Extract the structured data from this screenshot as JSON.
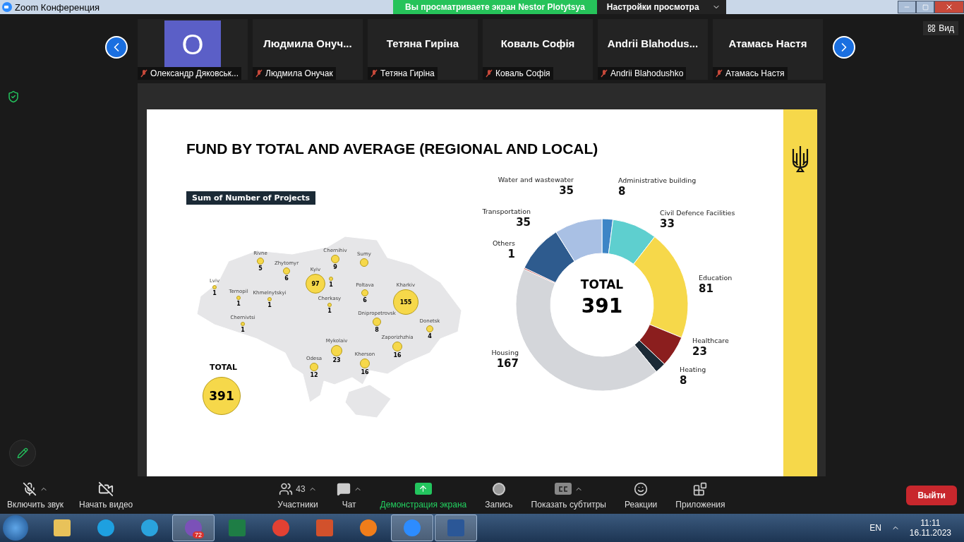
{
  "window": {
    "title": "Zoom Конференция"
  },
  "share_banner": {
    "text": "Вы просматриваете экран Nestor Plotytsya",
    "view_options": "Настройки просмотра"
  },
  "view_button": "Вид",
  "participants": [
    {
      "kind": "avatar",
      "tile_text": "O",
      "name": "Олександр Дяковськ...",
      "muted": true
    },
    {
      "kind": "name",
      "tile_text": "Людмила  Онуч...",
      "name": "Людмила Онучак",
      "muted": true
    },
    {
      "kind": "name",
      "tile_text": "Тетяна Гиріна",
      "name": "Тетяна Гиріна",
      "muted": true
    },
    {
      "kind": "name",
      "tile_text": "Коваль Софія",
      "name": "Коваль Софія",
      "muted": true
    },
    {
      "kind": "name",
      "tile_text": "Andrii  Blahodus...",
      "name": "Andrii Blahodushko",
      "muted": true
    },
    {
      "kind": "name",
      "tile_text": "Атамась Настя",
      "name": "Атамась Настя",
      "muted": true
    }
  ],
  "slide": {
    "title": "FUND BY TOTAL AND AVERAGE (REGIONAL AND LOCAL)",
    "map_label": "Sum of Number of Projects",
    "regions": [
      {
        "name": "Rivne",
        "value": "5"
      },
      {
        "name": "Chernihiv",
        "value": "9"
      },
      {
        "name": "Sumy"
      },
      {
        "name": "Zhytomyr",
        "value": "6"
      },
      {
        "name": "Kyiv",
        "value": "97"
      },
      {
        "value": "1"
      },
      {
        "name": "Lviv",
        "value": "1"
      },
      {
        "name": "Poltava",
        "value": "6"
      },
      {
        "name": "Ternopil",
        "value": "1"
      },
      {
        "name": "Khmelnytskyi",
        "value": "1"
      },
      {
        "name": "Kharkiv",
        "value": "155"
      },
      {
        "name": "Cherkasy",
        "value": "1"
      },
      {
        "name": "Chernivtsi",
        "value": "1"
      },
      {
        "name": "Dnipropetrovsk",
        "value": "8"
      },
      {
        "name": "Donetsk",
        "value": "4"
      },
      {
        "name": "Zaporizhzhia",
        "value": "16"
      },
      {
        "name": "Mykolaiv",
        "value": "23"
      },
      {
        "name": "Kherson",
        "value": "16"
      },
      {
        "name": "Odesa",
        "value": "12"
      }
    ],
    "total_label": "TOTAL",
    "total_value": "391",
    "donut_total_label": "TOTAL",
    "donut_total_value": "391",
    "chart_data": {
      "type": "donut",
      "data_labels": true,
      "categories": [
        "Administrative building",
        "Civil Defence Facilities",
        "Education",
        "Healthcare",
        "Heating",
        "Housing",
        "Others",
        "Transportation",
        "Water and wastewater"
      ],
      "values": [
        8,
        33,
        81,
        23,
        8,
        167,
        1,
        35,
        35
      ],
      "colors": [
        "#3d85c6",
        "#5ecfcf",
        "#f6d84a",
        "#8b1e1e",
        "#1b2a36",
        "#d4d6da",
        "#c0504d",
        "#2e5b8e",
        "#a9c0e4"
      ]
    }
  },
  "toolbar": [
    {
      "kind": "mic",
      "label": "Включить звук",
      "caret": true
    },
    {
      "kind": "video",
      "label": "Начать видео",
      "caret": false
    },
    {
      "kind": "participants",
      "label": "Участники",
      "count": "43",
      "caret": true
    },
    {
      "kind": "chat",
      "label": "Чат",
      "caret": true
    },
    {
      "kind": "share",
      "label": "Демонстрация экрана",
      "caret": false
    },
    {
      "kind": "record",
      "label": "Запись",
      "caret": false
    },
    {
      "kind": "captions",
      "label": "Показать субтитры",
      "caret": true
    },
    {
      "kind": "reactions",
      "label": "Реакции",
      "caret": false
    },
    {
      "kind": "apps",
      "label": "Приложения",
      "caret": false
    }
  ],
  "leave_button": "Выйти",
  "taskbar": {
    "apps": [
      {
        "kind": "folder",
        "active": false
      },
      {
        "kind": "skype",
        "active": false
      },
      {
        "kind": "telegram",
        "active": false
      },
      {
        "kind": "viber",
        "active": true,
        "badge": "72"
      },
      {
        "kind": "sheet",
        "active": false
      },
      {
        "kind": "chrome",
        "active": false
      },
      {
        "kind": "slides",
        "active": false
      },
      {
        "kind": "firefox",
        "active": false
      },
      {
        "kind": "zoom",
        "active": true
      },
      {
        "kind": "doc",
        "active": true
      }
    ],
    "language": "EN",
    "time": "11:11",
    "date": "16.11.2023"
  }
}
